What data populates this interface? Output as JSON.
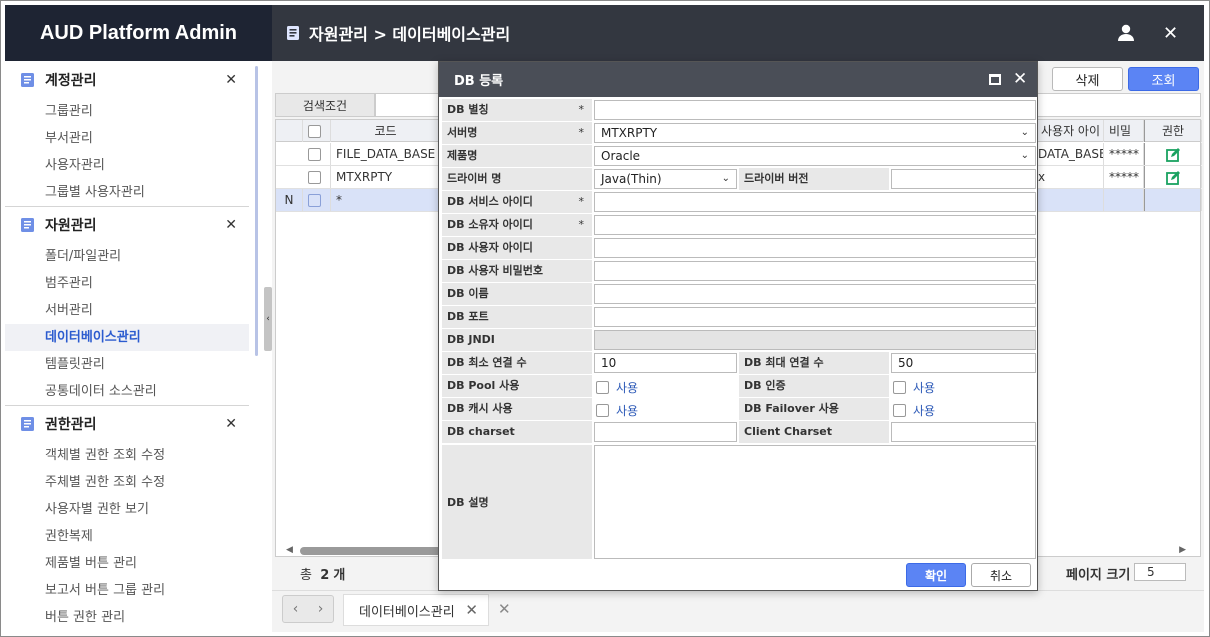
{
  "app": {
    "title": "AUD Platform Admin"
  },
  "header": {
    "breadcrumb": "자원관리 > 데이터베이스관리"
  },
  "sidebar": {
    "sections": [
      {
        "title": "계정관리",
        "items": [
          "그룹관리",
          "부서관리",
          "사용자관리",
          "그룹별 사용자관리"
        ]
      },
      {
        "title": "자원관리",
        "items": [
          "폴더/파일관리",
          "범주관리",
          "서버관리",
          "데이터베이스관리",
          "템플릿관리",
          "공통데이터 소스관리"
        ],
        "active_item": "데이터베이스관리"
      },
      {
        "title": "권한관리",
        "items": [
          "객체별 권한 조회 수정",
          "주체별 권한 조회 수정",
          "사용자별 권한 보기",
          "권한복제",
          "제품별 버튼 관리",
          "보고서 버튼 그룹 관리",
          "버튼 권한 관리"
        ]
      }
    ]
  },
  "toolbar": {
    "delete_label": "삭제",
    "search_label": "조회"
  },
  "search": {
    "label": "검색조건"
  },
  "grid": {
    "headers": {
      "code": "코드",
      "user_id": "사용자 아이",
      "password": "비밀",
      "auth": "권한"
    },
    "rows": [
      {
        "code": "FILE_DATA_BASE",
        "user_id": "DATA_BASE",
        "password": "*****"
      },
      {
        "code": "MTXRPTY",
        "user_id": "x",
        "password": "*****"
      }
    ],
    "new_row": {
      "marker": "N",
      "code": "*"
    },
    "total_label": "총",
    "total_count": "2",
    "total_unit": "개",
    "page_size_label": "페이지 크기",
    "page_size": "5"
  },
  "tabs": [
    {
      "label": "데이터베이스관리"
    }
  ],
  "dialog": {
    "title": "DB 등록",
    "fields": {
      "alias": {
        "label": "DB 별칭",
        "required": "*",
        "value": ""
      },
      "server": {
        "label": "서버명",
        "required": "*",
        "value": "MTXRPTY"
      },
      "product": {
        "label": "제품명",
        "value": "Oracle"
      },
      "driver": {
        "label": "드라이버 명",
        "value": "Java(Thin)"
      },
      "driver_version": {
        "label": "드라이버 버전",
        "value": ""
      },
      "service_id": {
        "label": "DB 서비스 아이디",
        "required": "*",
        "value": ""
      },
      "owner_id": {
        "label": "DB 소유자 아이디",
        "required": "*",
        "value": ""
      },
      "user_id": {
        "label": "DB 사용자 아이디",
        "value": ""
      },
      "user_pw": {
        "label": "DB 사용자 비밀번호",
        "value": ""
      },
      "db_name": {
        "label": "DB 이름",
        "value": ""
      },
      "port": {
        "label": "DB 포트",
        "value": ""
      },
      "jndi": {
        "label": "DB JNDI",
        "value": ""
      },
      "min_conn": {
        "label": "DB 최소 연결 수",
        "value": "10"
      },
      "max_conn": {
        "label": "DB 최대 연결 수",
        "value": "50"
      },
      "pool": {
        "label": "DB Pool 사용",
        "option": "사용"
      },
      "auth": {
        "label": "DB 인증",
        "option": "사용"
      },
      "cache": {
        "label": "DB 캐시 사용",
        "option": "사용"
      },
      "failover": {
        "label": "DB Failover 사용",
        "option": "사용"
      },
      "charset": {
        "label": "DB charset",
        "value": ""
      },
      "client_charset": {
        "label": "Client Charset",
        "value": ""
      },
      "description": {
        "label": "DB 설명",
        "value": ""
      }
    },
    "ok_label": "확인",
    "cancel_label": "취소"
  },
  "colors": {
    "primary": "#5b84f4",
    "header_bg": "#333740",
    "brand_bg": "#1e2433",
    "active_text": "#2b5bcf",
    "edit_icon": "#1aa260"
  }
}
